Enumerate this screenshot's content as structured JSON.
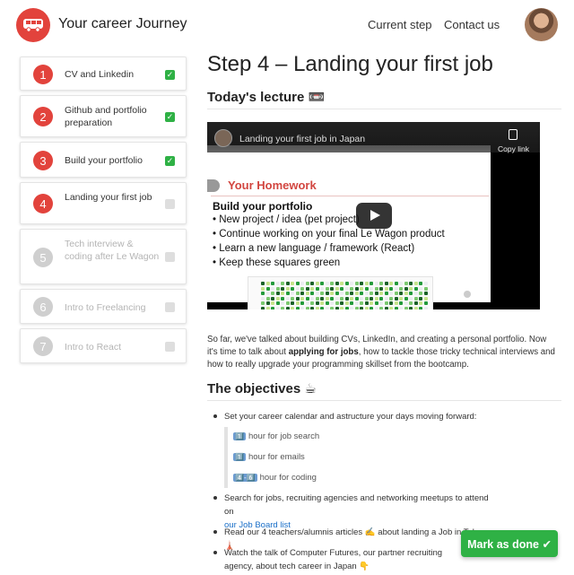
{
  "header": {
    "brand": "Your career Journey",
    "nav": {
      "current_step": "Current step",
      "contact": "Contact us"
    }
  },
  "sidebar": {
    "steps": [
      {
        "num": "1",
        "label": "CV and Linkedin",
        "state": "done"
      },
      {
        "num": "2",
        "label": "Github and portfolio preparation",
        "state": "done"
      },
      {
        "num": "3",
        "label": "Build your portfolio",
        "state": "done"
      },
      {
        "num": "4",
        "label": "Landing your first job",
        "state": "current"
      },
      {
        "num": "5",
        "label": "Tech interview & coding after Le Wagon",
        "state": "locked"
      },
      {
        "num": "6",
        "label": "Intro to Freelancing",
        "state": "locked"
      },
      {
        "num": "7",
        "label": "Intro to React",
        "state": "locked"
      }
    ]
  },
  "main": {
    "title": "Step 4 – Landing your first job",
    "lecture_heading": "Today's lecture 📼",
    "video": {
      "title": "Landing your first job in Japan",
      "copy_link": "Copy link",
      "slide_heading": "Your Homework",
      "slide_subheading": "Build your portfolio",
      "bullets": [
        "New project / idea (pet project)",
        "Continue working on your final Le Wagon product",
        "Learn a new language / framework (React)",
        "Keep these squares green"
      ]
    },
    "intro": {
      "part1": "So far, we've talked about building CVs, LinkedIn, and creating a personal portfolio. Now it's time to talk about ",
      "bold": "applying for jobs",
      "part2": ", how to tackle those tricky technical interviews and how to really upgrade your programming skillset from the bootcamp."
    },
    "objectives_heading": "The objectives ☕",
    "objectives": {
      "item1": "Set your career calendar and astructure your days moving forward:",
      "quote": [
        {
          "badge": "1️⃣",
          "text": "hour for job search"
        },
        {
          "badge": "1️⃣",
          "text": "hour for emails"
        },
        {
          "badge": "4️⃣-6️⃣",
          "text": "hour for coding"
        }
      ],
      "item2": "Search for jobs, recruiting agencies and networking meetups to attend on",
      "item2_link": "our Job Board list",
      "item3": "Read our 4 teachers/alumnis articles ✍️ about landing a Job in Tokyo 🗼",
      "item4": "Watch the talk of Computer Futures, our partner recruiting agency, about tech career in Japan 👇"
    },
    "mark_done": "Mark as done ✔"
  }
}
